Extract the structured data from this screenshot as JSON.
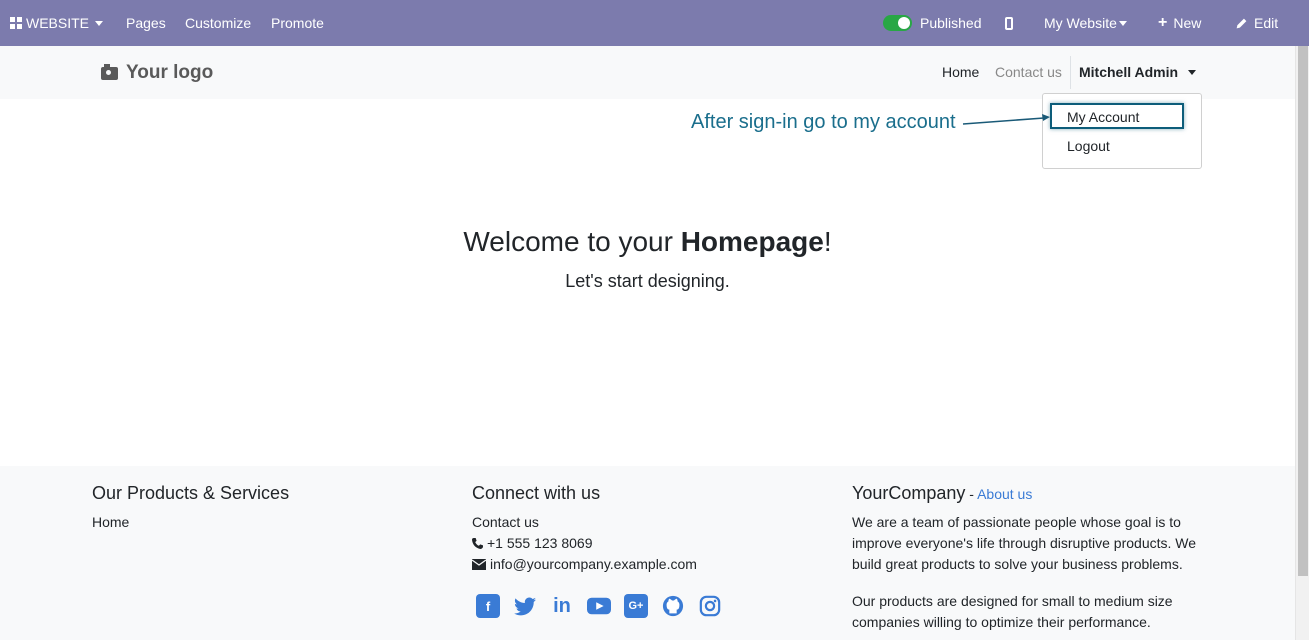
{
  "topbar": {
    "website_label": "WEBSITE",
    "pages_label": "Pages",
    "customize_label": "Customize",
    "promote_label": "Promote",
    "published_label": "Published",
    "my_website_label": "My Website",
    "new_label": "New",
    "edit_label": "Edit",
    "bg_color": "#7c7bad"
  },
  "header": {
    "logo_text": "Your logo",
    "nav_home": "Home",
    "nav_contact": "Contact us",
    "user_name": "Mitchell Admin"
  },
  "dropdown": {
    "my_account": "My Account",
    "logout": "Logout"
  },
  "annotation": {
    "text": "After sign-in go to my account"
  },
  "main": {
    "welcome_prefix": "Welcome to your ",
    "welcome_bold": "Homepage",
    "welcome_suffix": "!",
    "subtitle": "Let's start designing."
  },
  "footer": {
    "col1_title": "Our Products & Services",
    "col1_link": "Home",
    "col2_title": "Connect with us",
    "col2_link": "Contact us",
    "phone": "+1 555 123 8069",
    "email": "info@yourcompany.example.com",
    "col3_title": "YourCompany",
    "col3_sep": " - ",
    "col3_link": "About us",
    "about_p1": "We are a team of passionate people whose goal is to improve everyone's life through disruptive products. We build great products to solve your business problems.",
    "about_p2": "Our products are designed for small to medium size companies willing to optimize their performance.",
    "social_icons": [
      "facebook-icon",
      "twitter-icon",
      "linkedin-icon",
      "youtube-icon",
      "google-plus-icon",
      "github-icon",
      "instagram-icon"
    ]
  }
}
